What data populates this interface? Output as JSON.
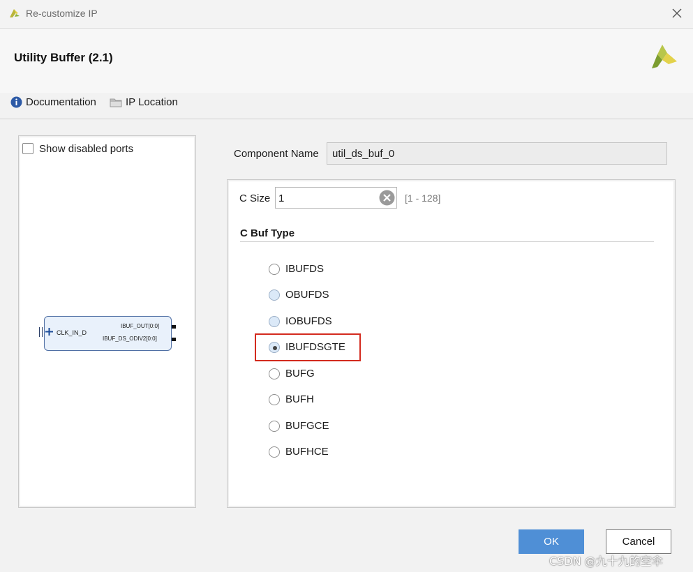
{
  "window": {
    "title": "Re-customize IP"
  },
  "header": {
    "ip_name": "Utility Buffer (2.1)",
    "documentation_label": "Documentation",
    "ip_location_label": "IP Location"
  },
  "left_panel": {
    "show_disabled_ports_label": "Show disabled ports",
    "show_disabled_ports_checked": false,
    "symbol": {
      "input_port": "CLK_IN_D",
      "output_ports": [
        "IBUF_OUT[0:0]",
        "IBUF_DS_ODIV2[0:0]"
      ]
    }
  },
  "component_name": {
    "label": "Component Name",
    "value": "util_ds_buf_0"
  },
  "c_size": {
    "label": "C Size",
    "value": "1",
    "range": "[1 - 128]"
  },
  "c_buf_type": {
    "heading": "C Buf Type",
    "options": [
      "IBUFDS",
      "OBUFDS",
      "IOBUFDS",
      "IBUFDSGTE",
      "BUFG",
      "BUFH",
      "BUFGCE",
      "BUFHCE"
    ],
    "selected": "IBUFDSGTE"
  },
  "buttons": {
    "ok": "OK",
    "cancel": "Cancel"
  },
  "watermark": "CSDN @九十九的空伞",
  "icons": {
    "app": "xilinx-logo-icon",
    "brand": "xilinx-logo-icon",
    "documentation": "info-icon",
    "ip_location": "folder-icon",
    "close": "close-icon",
    "clear": "clear-icon"
  },
  "colors": {
    "accent": "#4f8fd6",
    "highlight": "#d32a1e",
    "brand_green": "#8fb23a",
    "brand_yellow": "#e3d24b"
  }
}
